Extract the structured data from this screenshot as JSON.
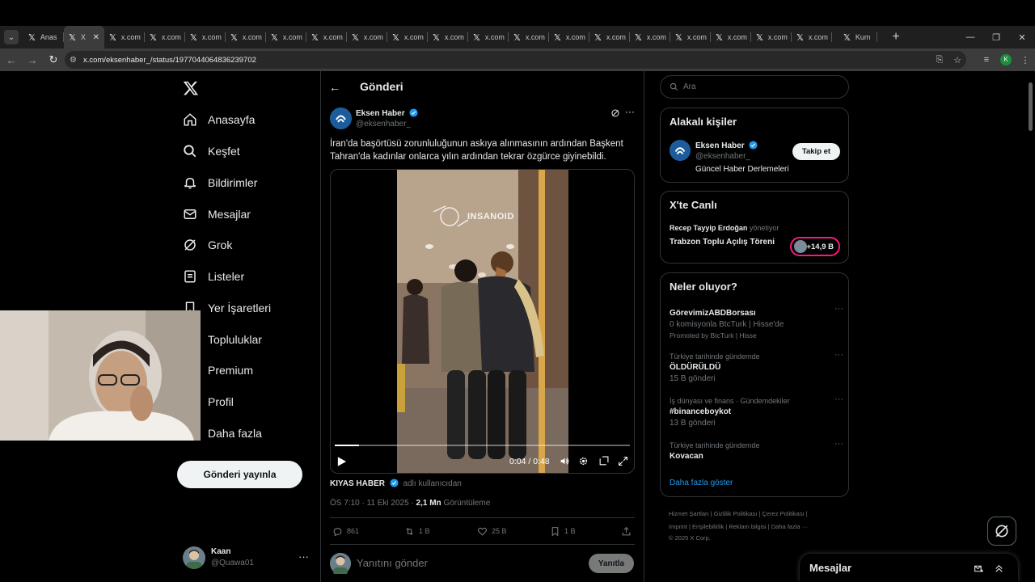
{
  "browser": {
    "tabs": [
      {
        "label": "Anas",
        "active": false
      },
      {
        "label": "X",
        "active": true
      },
      {
        "label": "x.com",
        "active": false
      },
      {
        "label": "x.com",
        "active": false
      },
      {
        "label": "x.com",
        "active": false
      },
      {
        "label": "x.com",
        "active": false
      },
      {
        "label": "x.com",
        "active": false
      },
      {
        "label": "x.com",
        "active": false
      },
      {
        "label": "x.com",
        "active": false
      },
      {
        "label": "x.com",
        "active": false
      },
      {
        "label": "x.com",
        "active": false
      },
      {
        "label": "x.com",
        "active": false
      },
      {
        "label": "x.com",
        "active": false
      },
      {
        "label": "x.com",
        "active": false
      },
      {
        "label": "x.com",
        "active": false
      },
      {
        "label": "x.com",
        "active": false
      },
      {
        "label": "x.com",
        "active": false
      },
      {
        "label": "x.com",
        "active": false
      },
      {
        "label": "x.com",
        "active": false
      },
      {
        "label": "x.com",
        "active": false
      },
      {
        "label": "Kum",
        "active": false
      }
    ],
    "url": "x.com/eksenhaber_/status/1977044064836239702",
    "profile_initial": "K"
  },
  "sidebar": {
    "items": [
      {
        "label": "Anasayfa",
        "icon": "home-icon"
      },
      {
        "label": "Keşfet",
        "icon": "search-icon"
      },
      {
        "label": "Bildirimler",
        "icon": "bell-icon"
      },
      {
        "label": "Mesajlar",
        "icon": "mail-icon"
      },
      {
        "label": "Grok",
        "icon": "grok-icon"
      },
      {
        "label": "Listeler",
        "icon": "list-icon"
      },
      {
        "label": "Yer İşaretleri",
        "icon": "bookmark-icon"
      },
      {
        "label": "Topluluklar",
        "icon": "communities-icon"
      },
      {
        "label": "Premium",
        "icon": "x-premium-icon"
      },
      {
        "label": "Profil",
        "icon": "profile-icon"
      },
      {
        "label": "Daha fazla",
        "icon": "more-icon"
      }
    ],
    "post_button": "Gönderi yayınla",
    "account": {
      "name": "Kaan",
      "handle": "@Quawa01"
    }
  },
  "post": {
    "header_title": "Gönderi",
    "author_name": "Eksen Haber",
    "author_handle": "@eksenhaber_",
    "text": "İran'da başörtüsü zorunluluğunun askıya alınmasının ardından Başkent Tahran'da kadınlar onlarca yılın ardından tekrar özgürce giyinebildi.",
    "video": {
      "watermark": "INSANOID",
      "time": "0:04 / 0:48",
      "progress": 0.083
    },
    "credit_name": "KIYAS HABER",
    "credit_suffix": "adlı kullanıcıdan",
    "timestamp": "ÖS 7:10 · 11 Eki 2025 · ",
    "views": "2,1 Mn",
    "views_label": "Görüntüleme",
    "replies": "861",
    "reposts": "1 B",
    "likes": "25 B",
    "bookmarks": "1 B",
    "reply_placeholder": "Yanıtını gönder",
    "reply_button": "Yanıtla"
  },
  "right": {
    "search_placeholder": "Ara",
    "related": {
      "title": "Alakalı kişiler",
      "name": "Eksen Haber",
      "handle": "@eksenhaber_",
      "bio": "Güncel Haber Derlemeleri",
      "follow": "Takip et"
    },
    "live": {
      "title": "X'te Canlı",
      "host": "Recep Tayyip Erdoğan",
      "host_suffix": "yönetiyor",
      "event": "Trabzon Toplu Açılış Töreni",
      "listeners": "+14,9 B"
    },
    "trends": {
      "title": "Neler oluyor?",
      "items": [
        {
          "context": "",
          "name": "GörevimizABDBorsası",
          "sub": "0 komisyonla BtcTurk | Hisse'de",
          "promo": "Promoted by BtcTurk | Hisse"
        },
        {
          "context": "Türkiye tarihinde gündemde",
          "name": "ÖLDÜRÜLDÜ",
          "sub": "15 B gönderi",
          "promo": ""
        },
        {
          "context": "İş dünyası ve finans · Gündemdekiler",
          "name": "#binanceboykot",
          "sub": "13 B gönderi",
          "promo": ""
        },
        {
          "context": "Türkiye tarihinde gündemde",
          "name": "Kovacan",
          "sub": "",
          "promo": ""
        }
      ],
      "show_more": "Daha fazla göster"
    },
    "footer": {
      "line1": "Hizmet Şartları | Gizlilik Politikası | Çerez Politikası |",
      "line2": "Imprint | Erişilebilirlik | Reklam bilgisi | Daha fazla ···",
      "line3": "© 2025 X Corp."
    },
    "messages_drawer": "Mesajlar"
  }
}
